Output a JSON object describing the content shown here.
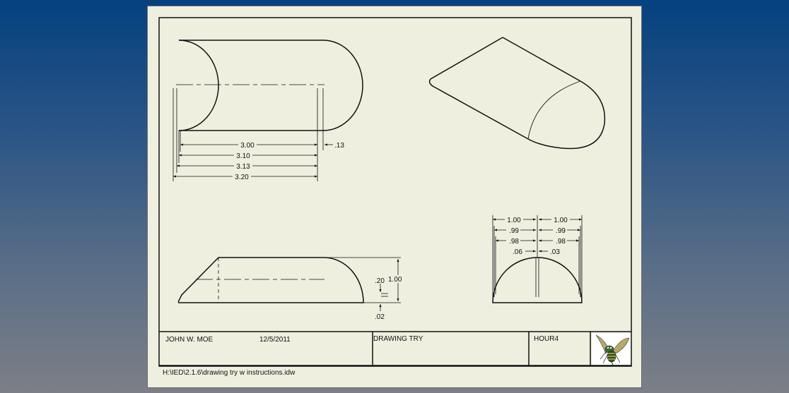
{
  "dimensions": {
    "top_view": {
      "d1": "3.00",
      "d2": "3.10",
      "d3": "3.13",
      "d4": "3.20",
      "d5": ".13"
    },
    "front_view": {
      "height": "1.00",
      "d20": ".20",
      "d02": ".02"
    },
    "side_view": {
      "left1": "1.00",
      "right1": "1.00",
      "left2": ".99",
      "right2": ".99",
      "left3": ".98",
      "right3": ".98",
      "left4": ".06",
      "right4": ".03"
    }
  },
  "title_block": {
    "author": "JOHN W. MOE",
    "date": "12/5/2011",
    "title": "DRAWING TRY",
    "period": "HOUR4",
    "file_path": "H:\\IED\\2.1.6\\drawing try w instructions.idw",
    "logo": "hornet-mascot-logo"
  },
  "colors": {
    "background_top": "#05417f",
    "background_bottom": "#7c7f86",
    "paper": "#efefe0",
    "line": "#111111"
  }
}
